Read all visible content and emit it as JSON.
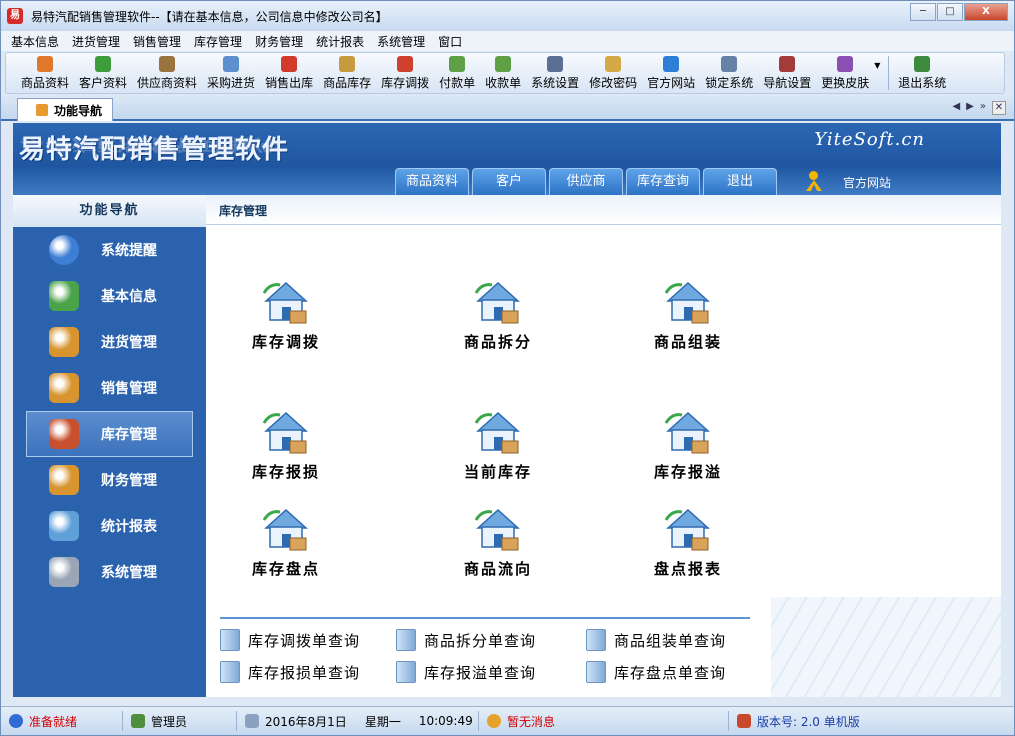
{
  "window": {
    "title": "易特汽配销售管理软件--【请在基本信息，公司信息中修改公司名】",
    "logo_text": "易",
    "controls": {
      "minimize": "─",
      "maximize": "□",
      "close": "X"
    }
  },
  "menu": [
    "基本信息",
    "进货管理",
    "销售管理",
    "库存管理",
    "财务管理",
    "统计报表",
    "系统管理",
    "窗口"
  ],
  "toolbar": {
    "items": [
      {
        "label": "商品资料",
        "color": "#e0772a"
      },
      {
        "label": "客户资料",
        "color": "#3f9c3a"
      },
      {
        "label": "供应商资料",
        "color": "#9a7440"
      },
      {
        "label": "采购进货",
        "color": "#5c8fcc"
      },
      {
        "label": "销售出库",
        "color": "#d23a2c"
      },
      {
        "label": "商品库存",
        "color": "#c79a3e"
      },
      {
        "label": "库存调拨",
        "color": "#d0402e"
      },
      {
        "label": "付款单",
        "color": "#5fa046"
      },
      {
        "label": "收款单",
        "color": "#5fa046"
      },
      {
        "label": "系统设置",
        "color": "#5a6f93"
      },
      {
        "label": "修改密码",
        "color": "#d6a948"
      },
      {
        "label": "官方网站",
        "color": "#2c7ed6"
      },
      {
        "label": "锁定系统",
        "color": "#6682a8"
      },
      {
        "label": "导航设置",
        "color": "#a33b3b"
      },
      {
        "label": "更换皮肤",
        "color": "#8a4fb3"
      }
    ],
    "exit_label": "退出系统",
    "exit_color": "#3c8a3c",
    "dropdown_glyph": "▼"
  },
  "doc_tabs": {
    "active": "功能导航",
    "nav": {
      "prev": "◀",
      "next": "▶",
      "more": "»",
      "close": "✕"
    }
  },
  "banner": {
    "title": "易特汽配销售管理软件",
    "brand": "YiteSoft.cn",
    "tabs": [
      "商品资料",
      "客户",
      "供应商",
      "库存查询",
      "退出"
    ],
    "site_label": "官方网站"
  },
  "sidebar": {
    "header": "功能导航",
    "items": [
      {
        "label": "系统提醒",
        "icon": "info-icon"
      },
      {
        "label": "基本信息",
        "icon": "cubes-icon"
      },
      {
        "label": "进货管理",
        "icon": "box-in-icon"
      },
      {
        "label": "销售管理",
        "icon": "box-out-icon"
      },
      {
        "label": "库存管理",
        "icon": "warehouse-icon"
      },
      {
        "label": "财务管理",
        "icon": "finance-icon"
      },
      {
        "label": "统计报表",
        "icon": "chart-icon"
      },
      {
        "label": "系统管理",
        "icon": "gears-icon"
      }
    ],
    "active_index": 4
  },
  "main": {
    "breadcrumb": "库存管理",
    "functions": [
      {
        "label": "库存调拨",
        "icon": "transfer-house-icon"
      },
      {
        "label": "商品拆分",
        "icon": "split-boxes-icon"
      },
      {
        "label": "商品组装",
        "icon": "assemble-box-icon"
      },
      {
        "label": "库存报损",
        "icon": "loss-house-icon"
      },
      {
        "label": "当前库存",
        "icon": "current-stock-icon"
      },
      {
        "label": "库存报溢",
        "icon": "overflow-house-icon"
      },
      {
        "label": "库存盘点",
        "icon": "scanner-icon"
      },
      {
        "label": "商品流向",
        "icon": "flow-house-icon"
      },
      {
        "label": "盘点报表",
        "icon": "report-search-icon"
      }
    ],
    "queries": [
      "库存调拨单查询",
      "商品拆分单查询",
      "商品组装单查询",
      "库存报损单查询",
      "库存报溢单查询",
      "库存盘点单查询"
    ]
  },
  "status": {
    "ready": "准备就绪",
    "user": "管理员",
    "date": "2016年8月1日",
    "weekday": "星期一",
    "time": "10:09:49",
    "message": "暂无消息",
    "version": "版本号: 2.0 单机版"
  }
}
